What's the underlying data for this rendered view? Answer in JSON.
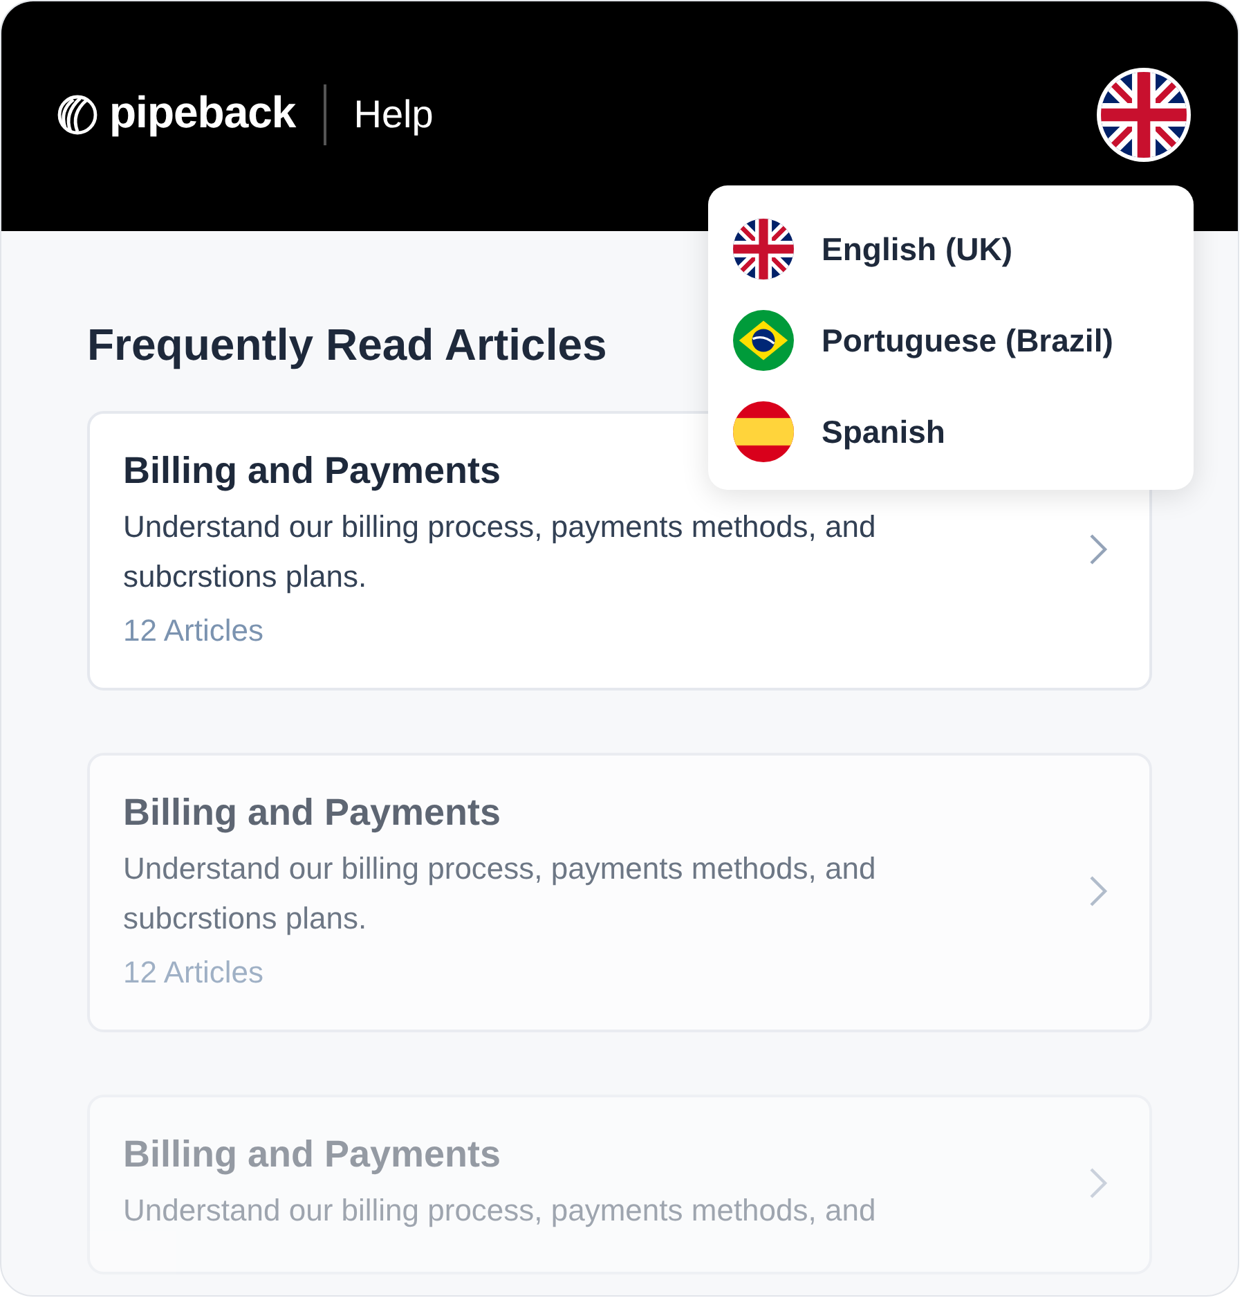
{
  "header": {
    "logo": "pipeback",
    "section": "Help",
    "language_button": {
      "kind": "uk"
    }
  },
  "language_menu": [
    {
      "kind": "uk",
      "label": "English (UK)"
    },
    {
      "kind": "br",
      "label": "Portuguese (Brazil)"
    },
    {
      "kind": "es",
      "label": "Spanish"
    }
  ],
  "heading": "Frequently Read Articles",
  "articles": [
    {
      "title": "Billing and Payments",
      "description": "Understand our billing process, payments methods, and subcrstions plans.",
      "count": "12 Articles"
    },
    {
      "title": "Billing and Payments",
      "description": "Understand our billing process, payments methods, and subcrstions plans.",
      "count": "12 Articles"
    },
    {
      "title": "Billing and Payments",
      "description": "Understand our billing process, payments methods, and"
    }
  ]
}
